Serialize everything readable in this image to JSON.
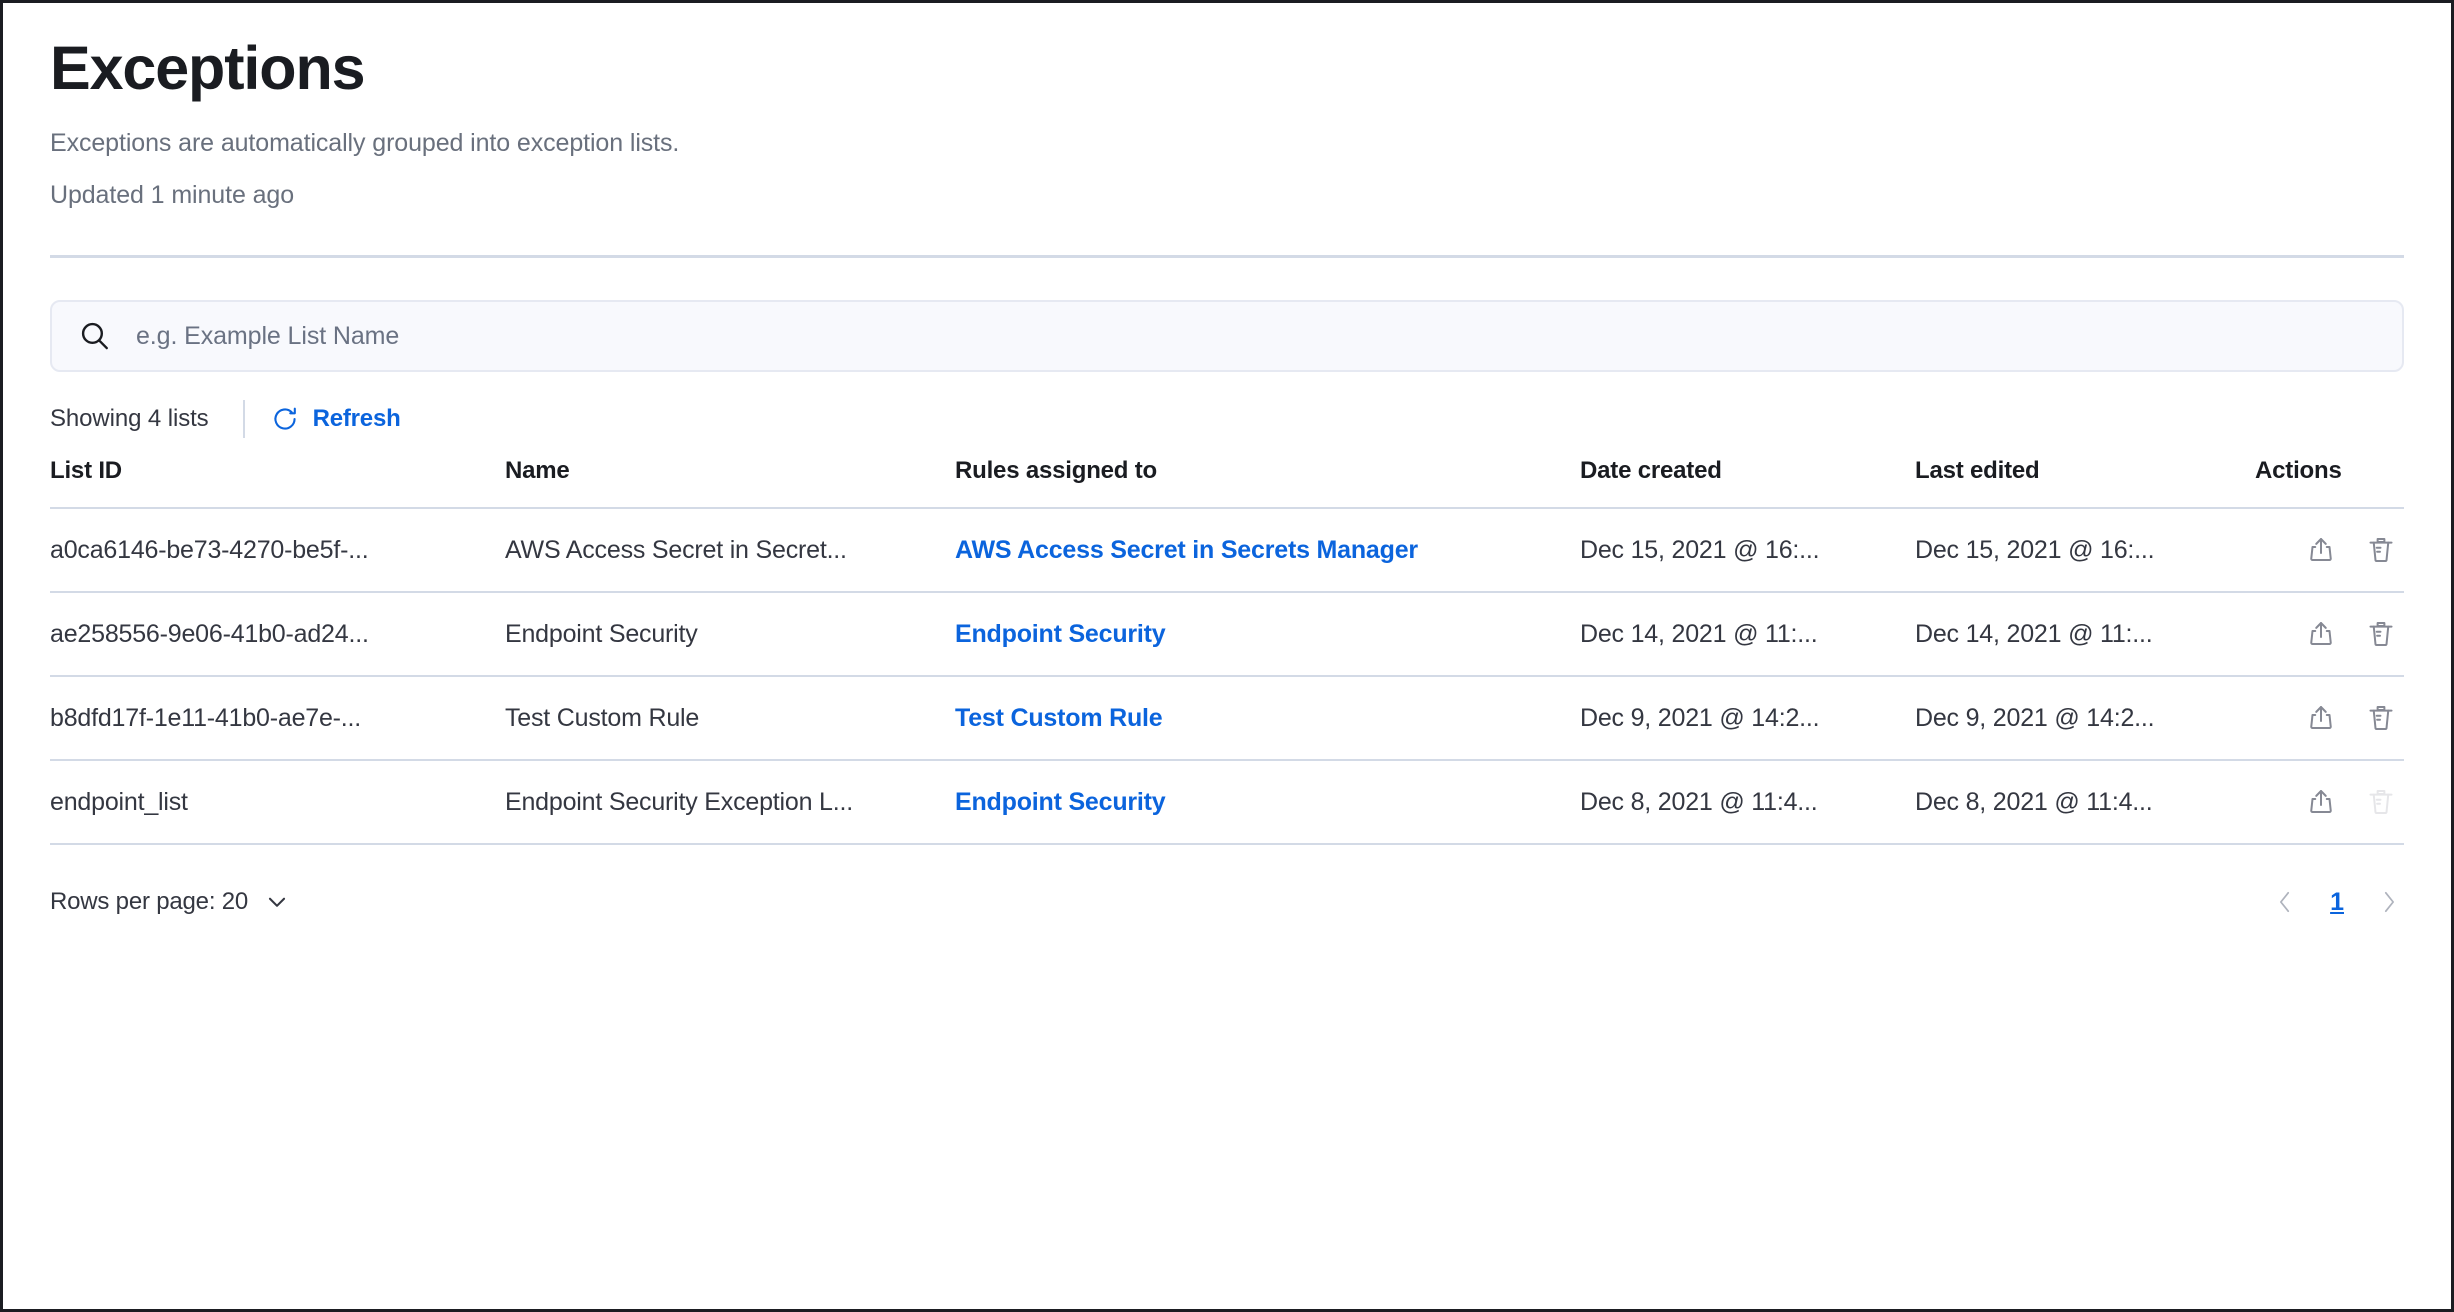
{
  "header": {
    "title": "Exceptions",
    "subtitle": "Exceptions are automatically grouped into exception lists.",
    "updated": "Updated 1 minute ago"
  },
  "search": {
    "placeholder": "e.g. Example List Name",
    "value": "",
    "icon": "search-icon"
  },
  "toolbar": {
    "showing": "Showing 4 lists",
    "refresh_label": "Refresh",
    "refresh_icon": "refresh-icon"
  },
  "table": {
    "columns": [
      {
        "key": "list_id",
        "label": "List ID"
      },
      {
        "key": "name",
        "label": "Name"
      },
      {
        "key": "rules",
        "label": "Rules assigned to"
      },
      {
        "key": "created",
        "label": "Date created"
      },
      {
        "key": "edited",
        "label": "Last edited"
      },
      {
        "key": "actions",
        "label": "Actions"
      }
    ],
    "rows": [
      {
        "list_id": "a0ca6146-be73-4270-be5f-...",
        "name": "AWS Access Secret in Secret...",
        "rules": "AWS Access Secret in Secrets Manager",
        "created": "Dec 15, 2021 @ 16:...",
        "edited": "Dec 15, 2021 @ 16:...",
        "export_icon": "export-icon",
        "delete_icon": "trash-icon",
        "delete_disabled": false
      },
      {
        "list_id": "ae258556-9e06-41b0-ad24...",
        "name": "Endpoint Security",
        "rules": "Endpoint Security",
        "created": "Dec 14, 2021 @ 11:...",
        "edited": "Dec 14, 2021 @ 11:...",
        "export_icon": "export-icon",
        "delete_icon": "trash-icon",
        "delete_disabled": false
      },
      {
        "list_id": "b8dfd17f-1e11-41b0-ae7e-...",
        "name": "Test Custom Rule",
        "rules": "Test Custom Rule",
        "created": "Dec 9, 2021 @ 14:2...",
        "edited": "Dec 9, 2021 @ 14:2...",
        "export_icon": "export-icon",
        "delete_icon": "trash-icon",
        "delete_disabled": false
      },
      {
        "list_id": "endpoint_list",
        "name": "Endpoint Security Exception L...",
        "rules": "Endpoint Security",
        "created": "Dec 8, 2021 @ 11:4...",
        "edited": "Dec 8, 2021 @ 11:4...",
        "export_icon": "export-icon",
        "delete_icon": "trash-icon",
        "delete_disabled": true
      }
    ]
  },
  "footer": {
    "rows_per_page_label": "Rows per page: 20",
    "rows_per_page_value": "20",
    "chevron_icon": "chevron-down-icon",
    "prev_icon": "chevron-left-icon",
    "next_icon": "chevron-right-icon",
    "current_page": "1"
  },
  "colors": {
    "link": "#0b64dd",
    "text": "#343741",
    "muted": "#69707d",
    "rule": "#d3dae6",
    "search_bg": "#f8f9fd",
    "border": "#1b1d22"
  }
}
